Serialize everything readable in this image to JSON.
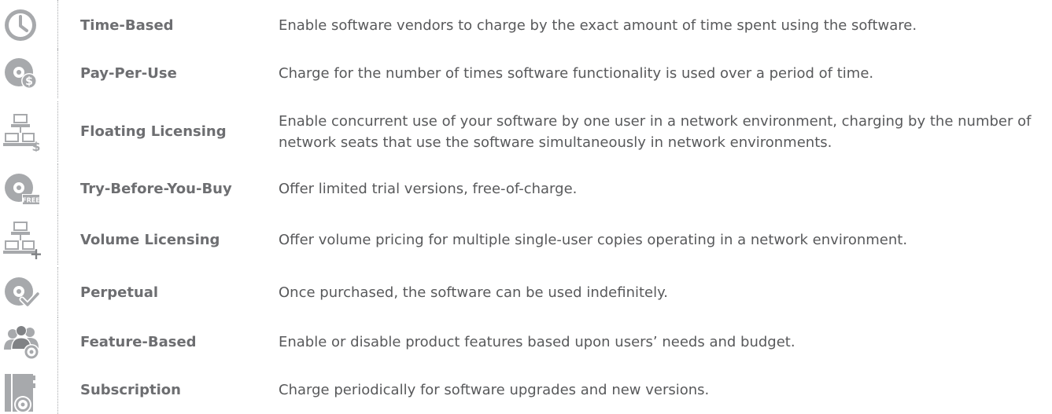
{
  "models": [
    {
      "icon": "clock-icon",
      "name": "Time-Based",
      "description": "Enable software vendors to charge by the exact amount of time spent using the software."
    },
    {
      "icon": "disc-dollar-icon",
      "name": "Pay-Per-Use",
      "description": "Charge for the number of times software functionality is used over a period of time."
    },
    {
      "icon": "network-dollar-icon",
      "name": "Floating Licensing",
      "description": "Enable concurrent use of your software by one user in a network environment, charging by the number of network seats that use the software simultaneously in network environments."
    },
    {
      "icon": "disc-free-icon",
      "name": "Try-Before-You-Buy",
      "description": "Offer limited trial versions, free-of-charge."
    },
    {
      "icon": "network-plus-icon",
      "name": "Volume Licensing",
      "description": "Offer volume pricing for multiple single-user copies operating in a network environment."
    },
    {
      "icon": "disc-check-icon",
      "name": "Perpetual",
      "description": "Once purchased, the software can be used indefinitely."
    },
    {
      "icon": "users-disc-icon",
      "name": "Feature-Based",
      "description": "Enable or disable product features based upon users’ needs and budget."
    },
    {
      "icon": "box-disc-icon",
      "name": "Subscription",
      "description": "Charge periodically for software upgrades and new versions."
    }
  ],
  "badges": {
    "dollar": "$",
    "free": "FREE",
    "plus": "+"
  },
  "colors": {
    "icon_gray": "#a7a9ac",
    "icon_dark": "#808285",
    "name_text": "#6d6e71",
    "desc_text": "#58595b"
  }
}
